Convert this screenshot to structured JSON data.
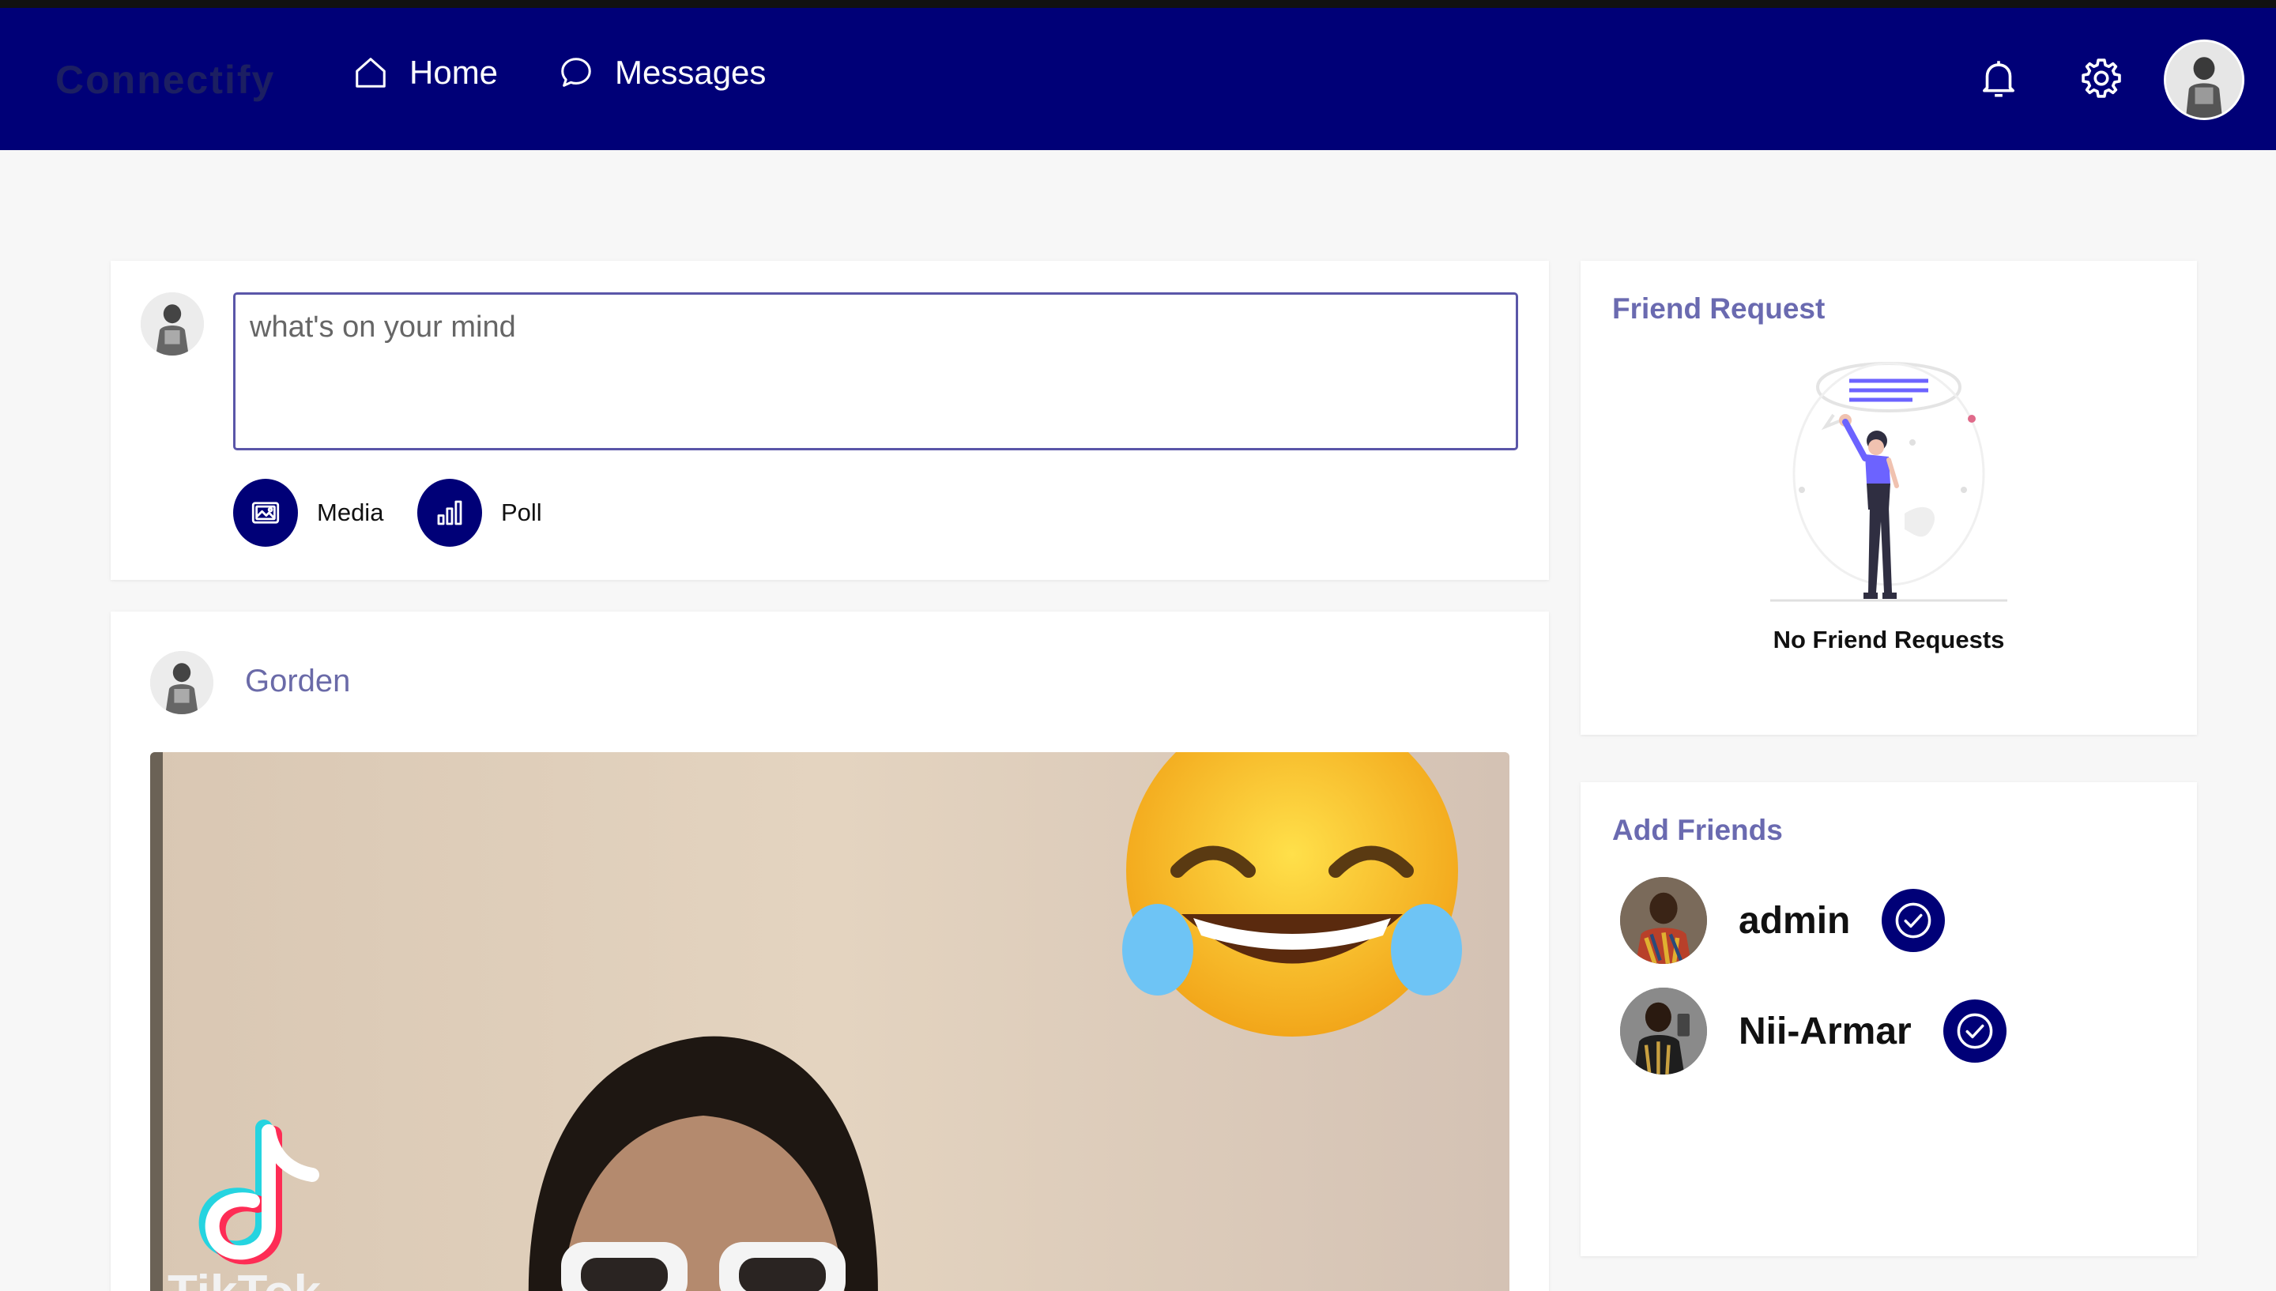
{
  "app": {
    "brand": "Connectify"
  },
  "nav": {
    "home_label": "Home",
    "messages_label": "Messages",
    "icons": [
      "home-icon",
      "message-icon",
      "bell-icon",
      "gear-icon",
      "user-avatar"
    ]
  },
  "composer": {
    "placeholder": "what's on your mind",
    "media_label": "Media",
    "poll_label": "Poll"
  },
  "post": {
    "author": "Gorden",
    "media_watermark": "TikTok"
  },
  "friend_request": {
    "title": "Friend Request",
    "empty_text": "No Friend Requests"
  },
  "add_friends": {
    "title": "Add Friends",
    "friends": [
      {
        "name": "admin"
      },
      {
        "name": "Nii-Armar"
      }
    ]
  },
  "colors": {
    "navbar": "#000077",
    "accent": "#000077",
    "section_title": "#6a6ab0",
    "page_bg": "#f7f7f7"
  }
}
